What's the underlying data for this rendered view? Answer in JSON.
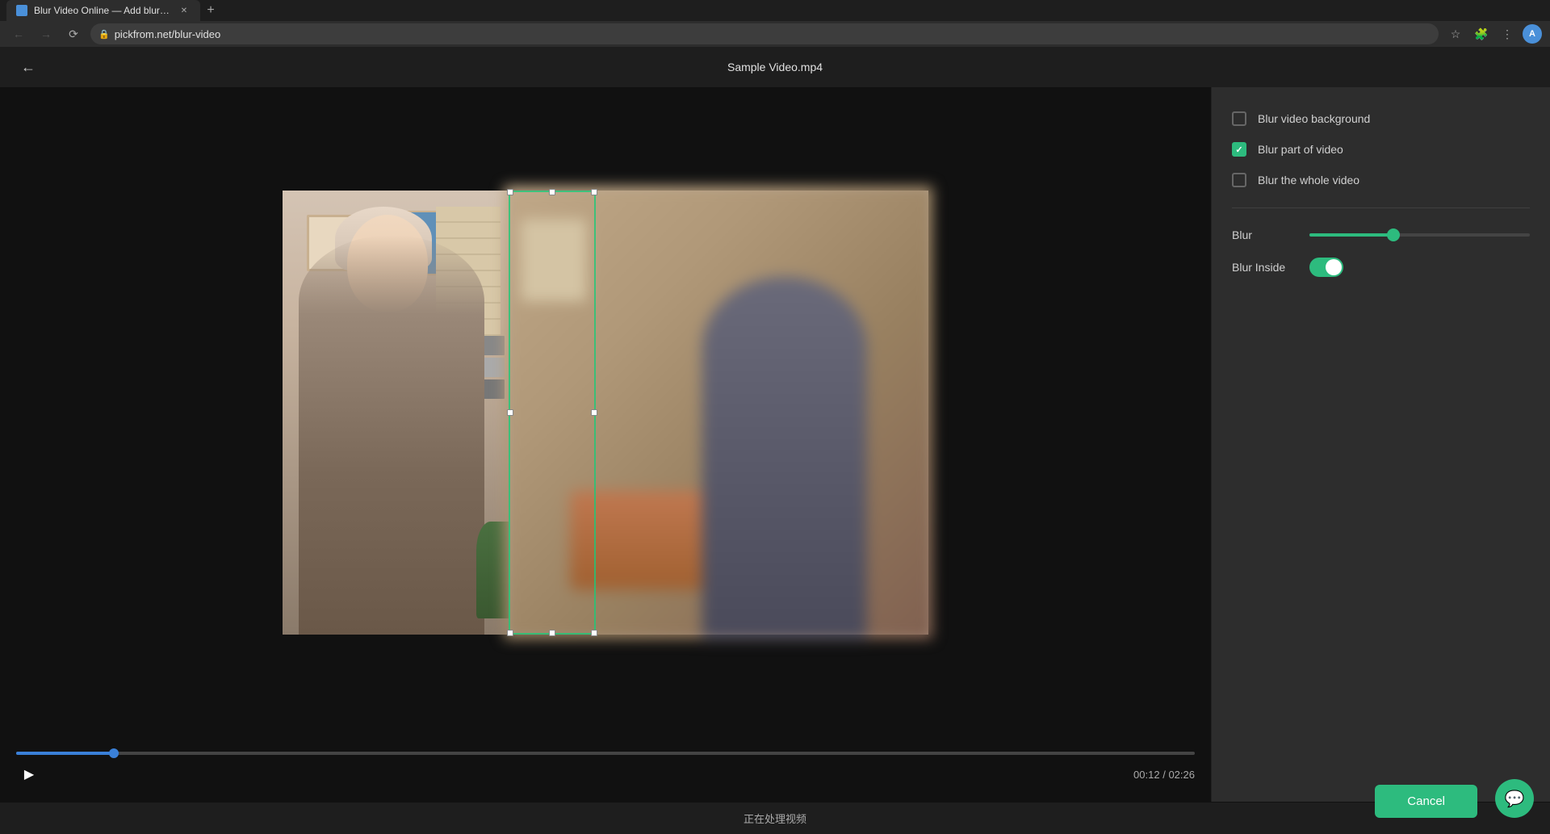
{
  "browser": {
    "tab_title": "Blur Video Online — Add blur e...",
    "url": "pickfrom.net/blur-video",
    "new_tab_label": "+"
  },
  "app": {
    "title": "Sample Video.mp4",
    "back_label": "←"
  },
  "options": {
    "blur_background": {
      "label": "Blur video background",
      "checked": false
    },
    "blur_part": {
      "label": "Blur part of video",
      "checked": true
    },
    "blur_whole": {
      "label": "Blur the whole video",
      "checked": false
    }
  },
  "blur_slider": {
    "label": "Blur",
    "value": 40,
    "fill_percent": "38%",
    "thumb_percent": "38%"
  },
  "blur_inside": {
    "label": "Blur Inside",
    "enabled": true
  },
  "video": {
    "current_time": "00:12",
    "total_time": "02:26",
    "progress_percent": "8.3%"
  },
  "status": {
    "text": "正在处理视频"
  },
  "buttons": {
    "cancel_label": "Cancel"
  }
}
